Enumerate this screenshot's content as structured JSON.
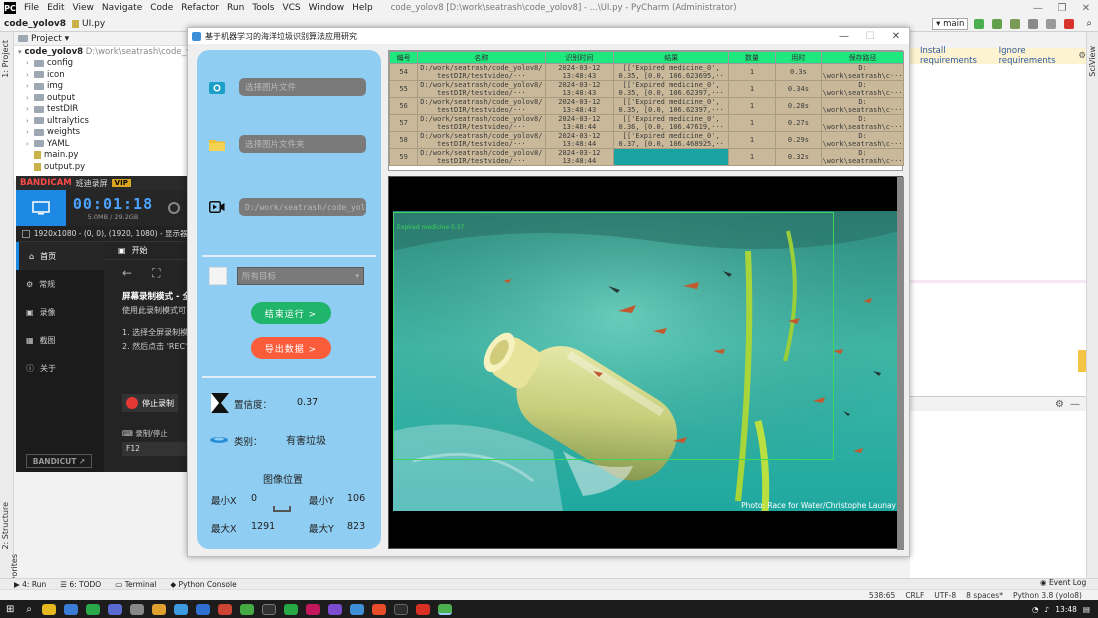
{
  "ide": {
    "menu": [
      "File",
      "Edit",
      "View",
      "Navigate",
      "Code",
      "Refactor",
      "Run",
      "Tools",
      "VCS",
      "Window",
      "Help"
    ],
    "window_title": "code_yolov8 [D:\\work\\seatrash\\code_yolov8] - ...\\UI.py - PyCharm (Administrator)",
    "breadcrumb_project": "code_yolov8",
    "breadcrumb_file": "UI.py",
    "branch": "main",
    "project_header": "Project",
    "tree": [
      {
        "label": "code_yolov8",
        "path": "D:\\work\\seatrash\\code_yolov8",
        "type": "root"
      },
      {
        "label": "config",
        "type": "folder"
      },
      {
        "label": "icon",
        "type": "folder"
      },
      {
        "label": "img",
        "type": "folder"
      },
      {
        "label": "output",
        "type": "folder"
      },
      {
        "label": "testDIR",
        "type": "folder"
      },
      {
        "label": "ultralytics",
        "type": "folder"
      },
      {
        "label": "weights",
        "type": "folder"
      },
      {
        "label": "YAML",
        "type": "folder"
      },
      {
        "label": "main.py",
        "type": "file"
      },
      {
        "label": "output.py",
        "type": "file"
      }
    ],
    "left_strip": [
      "1: Project",
      "2: Structure",
      "2: Favorites"
    ],
    "right_strip": [
      "SciView"
    ],
    "requirements": {
      "install": "Install requirements",
      "ignore": "Ignore requirements"
    },
    "bottom_tools": [
      "4: Run",
      "6: TODO",
      "Terminal",
      "Python Console"
    ],
    "event_log": "Event Log",
    "status": [
      "538:65",
      "CRLF",
      "UTF-8",
      "8 spaces*",
      "Python 3.8 (yolo8)"
    ],
    "clock": "13:48",
    "colors": {
      "accent": "#1e88e5"
    }
  },
  "bandicam": {
    "brand": "BANDICAM",
    "brand_sub": "班迪录屏",
    "vip": "VIP",
    "timer": "00:01:18",
    "size": "5.0MB / 29.2GB",
    "resolution": "1920x1080 - (0, 0), (1920, 1080) - 显示器 1",
    "nav": [
      "首页",
      "常规",
      "录像",
      "截图",
      "关于"
    ],
    "tabs": [
      "开始"
    ],
    "mode_title": "屏幕录制模式 - 全",
    "mode_desc": "使用此录制模式可以录",
    "step1": "1. 选择全屏录制模式，",
    "step2": "2. 然后点击 'REC' 按",
    "stop_label": "停止录制",
    "hotkey_label": "录制/停止",
    "hotkey_value": "F12",
    "bandicut": "BANDICUT ↗"
  },
  "app": {
    "title": "基于机器学习的海洋垃圾识别算法应用研究",
    "inputs": {
      "image": "选择图片文件",
      "folder": "选择图片文件夹",
      "video": "D:/work/seatrash/code_yolov8"
    },
    "target_select": "所有目标",
    "stop_button": "结束运行 >",
    "export_button": "导出数据 >",
    "confidence_label": "置信度：",
    "confidence_value": "0.37",
    "class_label": "类别：",
    "class_value": "有害垃圾",
    "position_title": "图像位置",
    "xmin_label": "最小X",
    "xmin_value": "0",
    "ymin_label": "最小Y",
    "ymin_value": "106",
    "xmax_label": "最大X",
    "xmax_value": "1291",
    "ymax_label": "最大Y",
    "ymax_value": "823",
    "table": {
      "headers": [
        "编号",
        "名称",
        "识别时间",
        "结果",
        "数量",
        "用时",
        "保存路径"
      ],
      "rows": [
        {
          "id": "54",
          "name": [
            "D:/work/seatrash/code_yolov8/",
            "testDIR/testvideo/···"
          ],
          "time": [
            "2024-03-12",
            "13:48:43"
          ],
          "result": [
            "[['Expired medicine_0',",
            "0.35, [0.0, 106.623695,··"
          ],
          "count": "1",
          "elapsed": "0.3s",
          "path": [
            "D:",
            "\\work\\seatrash\\c···"
          ],
          "selected": false
        },
        {
          "id": "55",
          "name": [
            "D:/work/seatrash/code_yolov8/",
            "testDIR/testvideo/···"
          ],
          "time": [
            "2024-03-12",
            "13:48:43"
          ],
          "result": [
            "[['Expired medicine_0',",
            "0.35, [0.0, 106.62397,···"
          ],
          "count": "1",
          "elapsed": "0.34s",
          "path": [
            "D:",
            "\\work\\seatrash\\c···"
          ],
          "selected": false
        },
        {
          "id": "56",
          "name": [
            "D:/work/seatrash/code_yolov8/",
            "testDIR/testvideo/···"
          ],
          "time": [
            "2024-03-12",
            "13:48:43"
          ],
          "result": [
            "[['Expired medicine_0',",
            "0.35, [0.0, 106.62397,···"
          ],
          "count": "1",
          "elapsed": "0.28s",
          "path": [
            "D:",
            "\\work\\seatrash\\c···"
          ],
          "selected": false
        },
        {
          "id": "57",
          "name": [
            "D:/work/seatrash/code_yolov8/",
            "testDIR/testvideo/···"
          ],
          "time": [
            "2024-03-12",
            "13:48:44"
          ],
          "result": [
            "[['Expired medicine_0',",
            "0.36, [0.0, 106.47619,···"
          ],
          "count": "1",
          "elapsed": "0.27s",
          "path": [
            "D:",
            "\\work\\seatrash\\c···"
          ],
          "selected": false
        },
        {
          "id": "58",
          "name": [
            "D:/work/seatrash/code_yolov8/",
            "testDIR/testvideo/···"
          ],
          "time": [
            "2024-03-12",
            "13:48:44"
          ],
          "result": [
            "[['Expired medicine_0',",
            "0.37, [0.0, 106.468925,··"
          ],
          "count": "1",
          "elapsed": "0.29s",
          "path": [
            "D:",
            "\\work\\seatrash\\c···"
          ],
          "selected": false
        },
        {
          "id": "59",
          "name": [
            "D:/work/seatrash/code_yolov8/",
            "testDIR/testvideo/···"
          ],
          "time": [
            "2024-03-12",
            "13:48:44"
          ],
          "result": [
            "",
            ""
          ],
          "count": "1",
          "elapsed": "0.32s",
          "path": [
            "D:",
            "\\work\\seatrash\\c···"
          ],
          "selected": true
        }
      ]
    },
    "detection_label": "Expired medicine 0.37",
    "photo_credit": "Photo: Race for Water/Christophe Launay"
  }
}
